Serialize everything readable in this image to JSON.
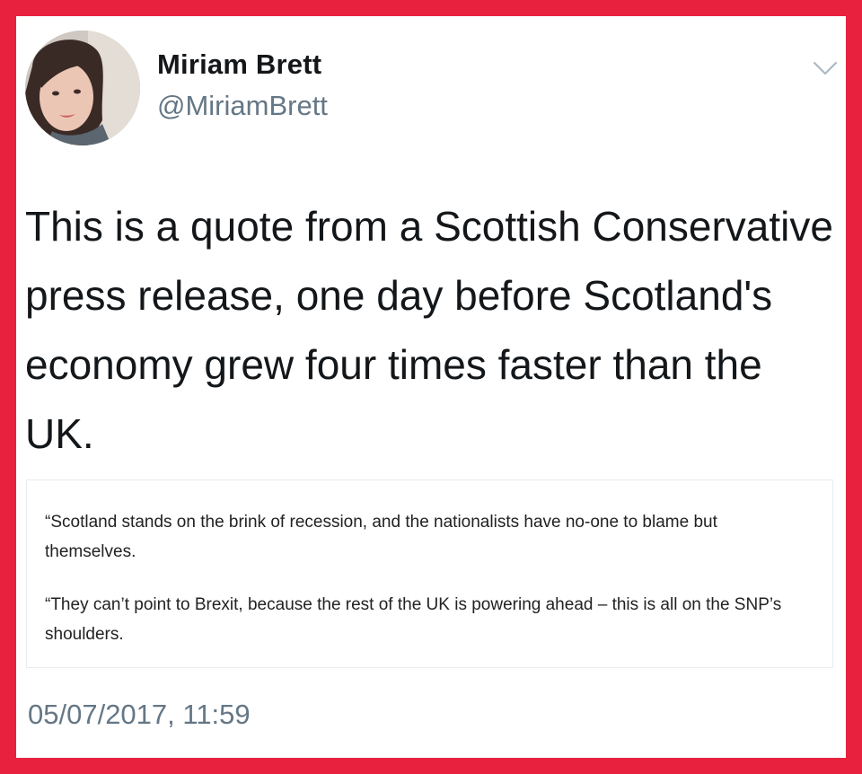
{
  "colors": {
    "frame": "#e8213f",
    "card": "#ffffff",
    "text_primary": "#14171a",
    "text_secondary": "#657786"
  },
  "author": {
    "name": "Miriam Brett",
    "handle": "@MiriamBrett",
    "avatar_icon": "profile-photo"
  },
  "menu": {
    "icon": "chevron-down-icon"
  },
  "tweet": {
    "text": "This is a quote from a Scottish Conservative press release, one day before Scotland's economy grew four times faster than the UK."
  },
  "quote": {
    "paragraphs": [
      "“Scotland stands on the brink of recession, and the nationalists have no-one to blame but themselves.",
      "“They can’t point to Brexit, because the rest of the UK is powering ahead – this is all on the SNP’s shoulders."
    ]
  },
  "timestamp": "05/07/2017, 11:59"
}
